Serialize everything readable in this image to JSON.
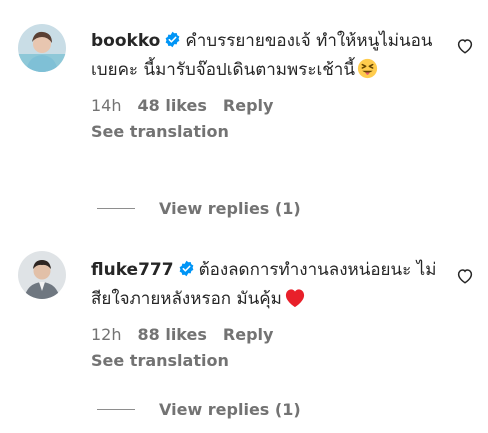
{
  "comments": [
    {
      "username": "bookko",
      "verified": true,
      "text": "คำบรรยายของเจ้ ทำให้หนูไม่นอนเบยคะ นี้มารับจ๊อปเดินตามพระเช้านี้",
      "emoji": "squinting-tongue-face",
      "time": "14h",
      "likes": "48 likes",
      "reply_label": "Reply",
      "translation_label": "See translation",
      "view_replies_label": "View replies (1)"
    },
    {
      "username": "fluke777",
      "verified": true,
      "text": "ต้องลดการทำงานลงหน่อยนะ ไม่สียใจภายหลังหรอก มันคุ้ม",
      "emoji": "red-heart",
      "time": "12h",
      "likes": "88 likes",
      "reply_label": "Reply",
      "translation_label": "See translation",
      "view_replies_label": "View replies (1)"
    }
  ],
  "colors": {
    "text": "#262626",
    "secondary": "#737373",
    "verified": "#0095f6",
    "heart_emoji": "#e8202a"
  }
}
